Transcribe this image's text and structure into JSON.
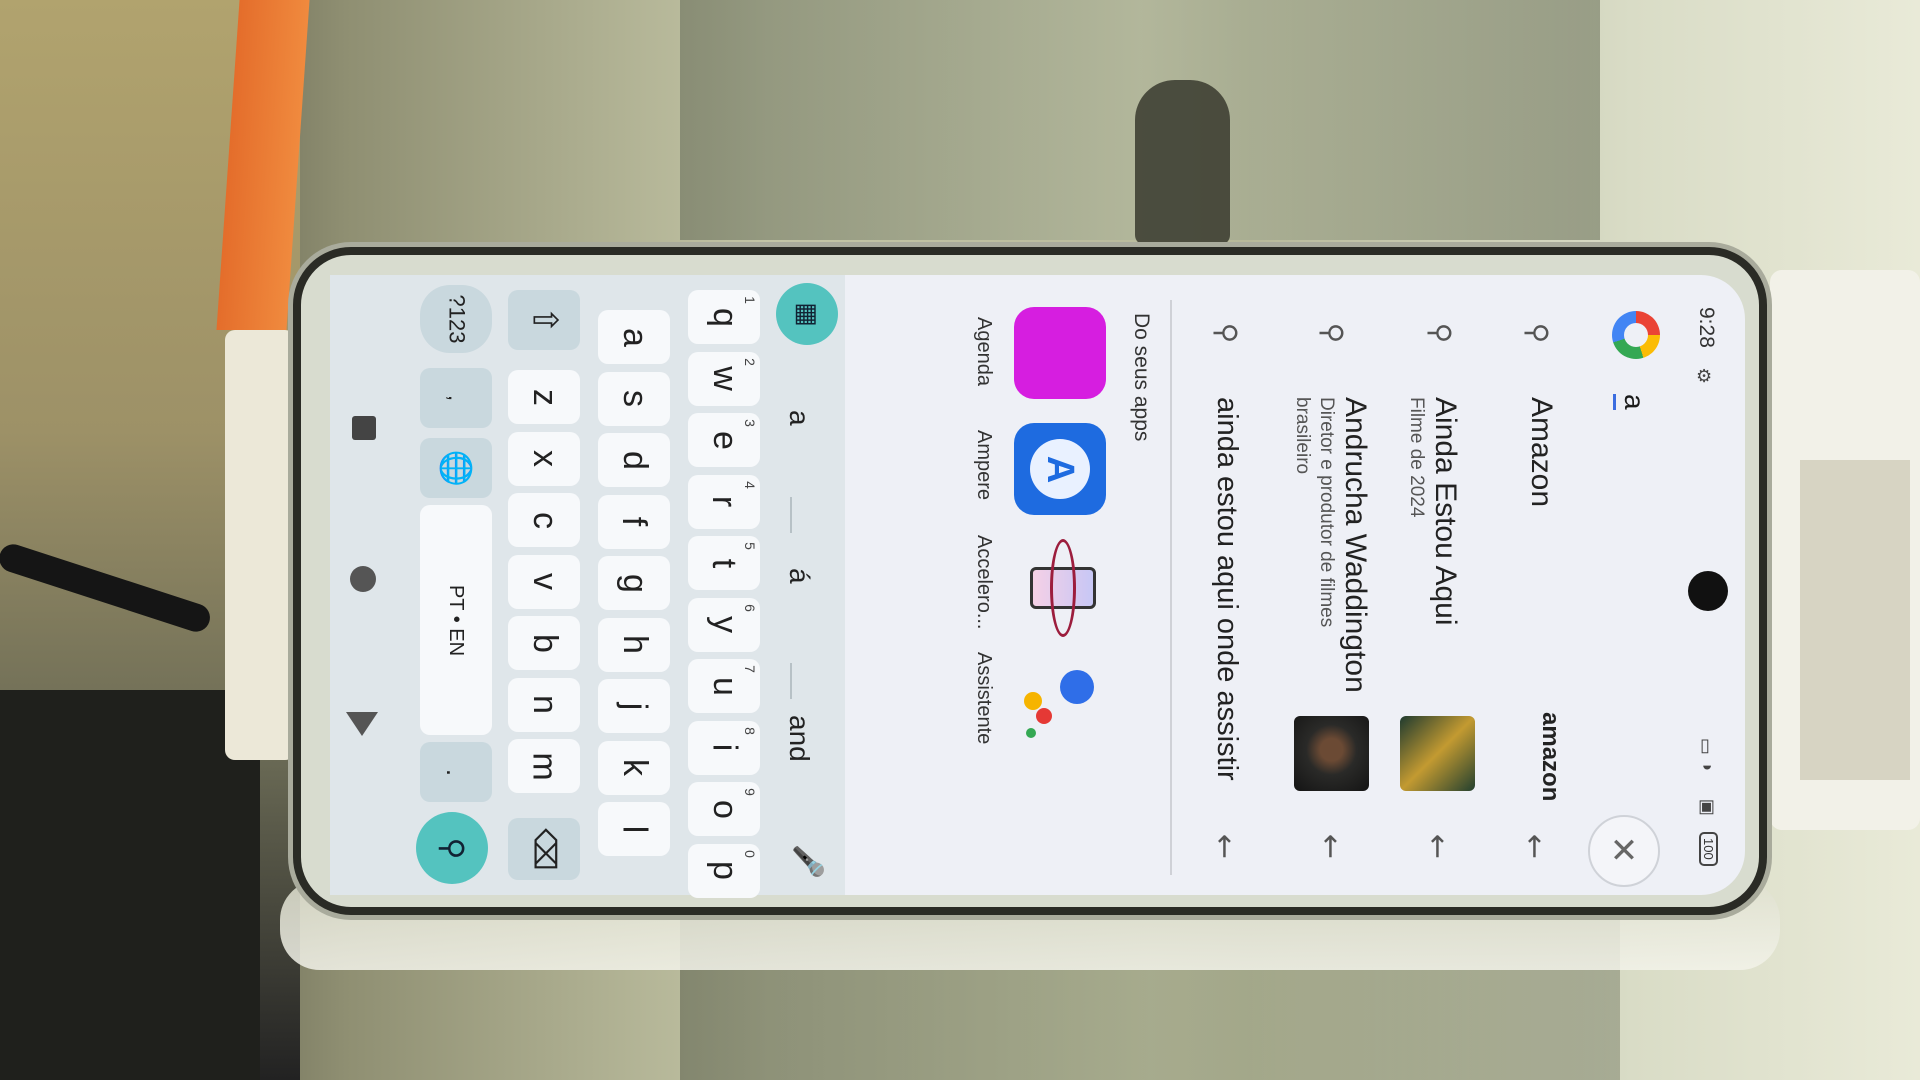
{
  "status_bar": {
    "time": "9:28",
    "battery": "100",
    "icons": [
      "settings-icon",
      "nfc-icon",
      "wifi-icon",
      "sim-off-icon",
      "battery-icon"
    ]
  },
  "search": {
    "query": "a",
    "clear_icon": "close-icon"
  },
  "suggestions": [
    {
      "title": "Amazon",
      "subtitle": "",
      "icon": "search-icon",
      "thumb": "amazon-logo"
    },
    {
      "title": "Ainda Estou Aqui",
      "subtitle": "Filme de 2024",
      "icon": "search-icon",
      "thumb": "movie-poster"
    },
    {
      "title": "Andrucha Waddington",
      "subtitle": "Diretor e produtor de filmes brasileiro",
      "icon": "search-icon",
      "thumb": "person-photo"
    },
    {
      "title": "ainda estou aqui onde assistir",
      "subtitle": "",
      "icon": "search-icon",
      "thumb": ""
    }
  ],
  "amazon_thumb_text": "amazon",
  "apps_section": {
    "title": "Do seus apps",
    "apps": [
      {
        "label": "Agenda",
        "color": "#d61ee0"
      },
      {
        "label": "Ampere",
        "color": "#1e6be0"
      },
      {
        "label": "Accelero...",
        "color": "#ffffff"
      },
      {
        "label": "Assistente",
        "color": "#ffffff"
      }
    ]
  },
  "keyboard": {
    "suggestions": [
      "a",
      "á",
      "and"
    ],
    "row1": [
      {
        "k": "q",
        "n": "1"
      },
      {
        "k": "w",
        "n": "2"
      },
      {
        "k": "e",
        "n": "3"
      },
      {
        "k": "r",
        "n": "4"
      },
      {
        "k": "t",
        "n": "5"
      },
      {
        "k": "y",
        "n": "6"
      },
      {
        "k": "u",
        "n": "7"
      },
      {
        "k": "i",
        "n": "8"
      },
      {
        "k": "o",
        "n": "9"
      },
      {
        "k": "p",
        "n": "0"
      }
    ],
    "row2": [
      "a",
      "s",
      "d",
      "f",
      "g",
      "h",
      "j",
      "k",
      "l"
    ],
    "row3": [
      "z",
      "x",
      "c",
      "v",
      "b",
      "n",
      "m"
    ],
    "symbols_key": "?123",
    "comma_key": ",",
    "space_label": "PT • EN",
    "period_key": ".",
    "accent_color": "#54c3bf"
  }
}
